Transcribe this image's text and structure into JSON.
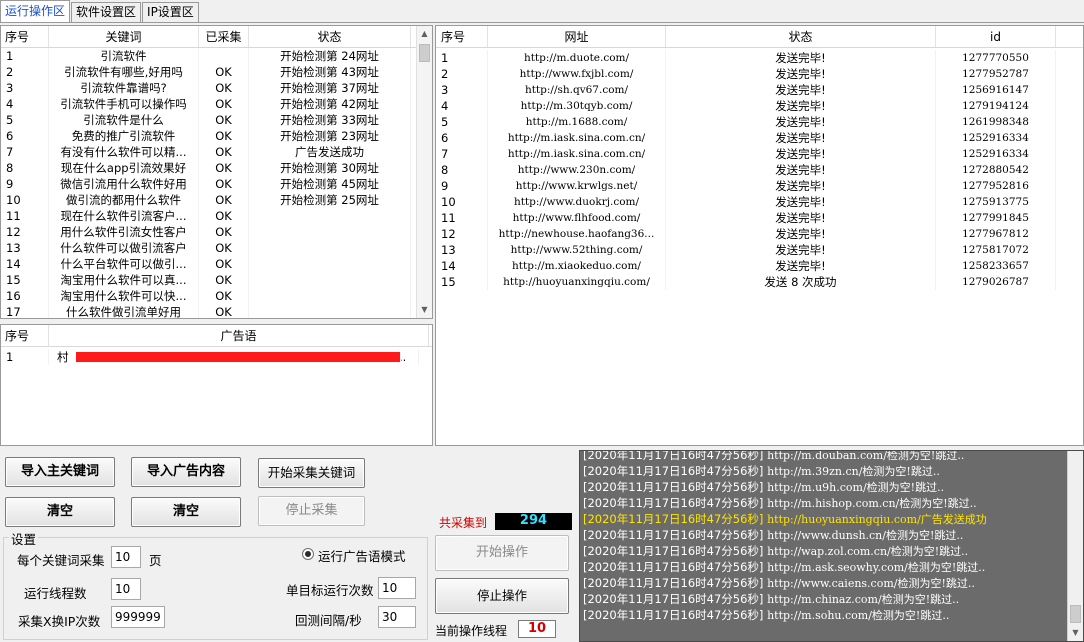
{
  "tabs": [
    "运行操作区",
    "软件设置区",
    "IP设置区"
  ],
  "keywords": {
    "headers": [
      "序号",
      "关键词",
      "已采集",
      "状态"
    ],
    "rows": [
      [
        "1",
        "引流软件",
        "",
        "开始检测第 24网址"
      ],
      [
        "2",
        "引流软件有哪些,好用吗",
        "OK",
        "开始检测第 43网址"
      ],
      [
        "3",
        "引流软件靠谱吗?",
        "OK",
        "开始检测第 37网址"
      ],
      [
        "4",
        "引流软件手机可以操作吗",
        "OK",
        "开始检测第 42网址"
      ],
      [
        "5",
        "引流软件是什么",
        "OK",
        "开始检测第 33网址"
      ],
      [
        "6",
        "免费的推广引流软件",
        "OK",
        "开始检测第 23网址"
      ],
      [
        "7",
        "有没有什么软件可以精...",
        "OK",
        "广告发送成功"
      ],
      [
        "8",
        "现在什么app引流效果好",
        "OK",
        "开始检测第 30网址"
      ],
      [
        "9",
        "微信引流用什么软件好用",
        "OK",
        "开始检测第 45网址"
      ],
      [
        "10",
        "做引流的都用什么软件",
        "OK",
        "开始检测第 25网址"
      ],
      [
        "11",
        "现在什么软件引流客户...",
        "OK",
        ""
      ],
      [
        "12",
        "用什么软件引流女性客户",
        "OK",
        ""
      ],
      [
        "13",
        "什么软件可以做引流客户",
        "OK",
        ""
      ],
      [
        "14",
        "什么平台软件可以做引...",
        "OK",
        ""
      ],
      [
        "15",
        "淘宝用什么软件可以真...",
        "OK",
        ""
      ],
      [
        "16",
        "淘宝用什么软件可以快...",
        "OK",
        ""
      ],
      [
        "17",
        "什么软件做引流单好用",
        "OK",
        ""
      ]
    ]
  },
  "ads": {
    "headers": [
      "序号",
      "广告语"
    ],
    "rows": [
      [
        "1",
        "村",
        ".."
      ]
    ]
  },
  "sites": {
    "headers": [
      "序号",
      "网址",
      "状态",
      "id"
    ],
    "rows": [
      [
        "1",
        "http://m.duote.com/",
        "发送完毕!",
        "1277770550"
      ],
      [
        "2",
        "http://www.fxjbl.com/",
        "发送完毕!",
        "1277952787"
      ],
      [
        "3",
        "http://sh.qv67.com/",
        "发送完毕!",
        "1256916147"
      ],
      [
        "4",
        "http://m.30tqyb.com/",
        "发送完毕!",
        "1279194124"
      ],
      [
        "5",
        "http://m.1688.com/",
        "发送完毕!",
        "1261998348"
      ],
      [
        "6",
        "http://m.iask.sina.com.cn/",
        "发送完毕!",
        "1252916334"
      ],
      [
        "7",
        "http://m.iask.sina.com.cn/",
        "发送完毕!",
        "1252916334"
      ],
      [
        "8",
        "http://www.230n.com/",
        "发送完毕!",
        "1272880542"
      ],
      [
        "9",
        "http://www.krwlgs.net/",
        "发送完毕!",
        "1277952816"
      ],
      [
        "10",
        "http://www.duokrj.com/",
        "发送完毕!",
        "1275913775"
      ],
      [
        "11",
        "http://www.flhfood.com/",
        "发送完毕!",
        "1277991845"
      ],
      [
        "12",
        "http://newhouse.haofang36...",
        "发送完毕!",
        "1277967812"
      ],
      [
        "13",
        "http://www.52thing.com/",
        "发送完毕!",
        "1275817072"
      ],
      [
        "14",
        "http://m.xiaokeduo.com/",
        "发送完毕!",
        "1258233657"
      ],
      [
        "15",
        "http://huoyuanxingqiu.com/",
        "发送 8 次成功",
        "1279026787"
      ]
    ]
  },
  "buttons": {
    "import_keywords": "导入主关键词",
    "import_ads": "导入广告内容",
    "start_collect": "开始采集关键词",
    "clear1": "清空",
    "clear2": "清空",
    "stop_collect": "停止采集",
    "start_op": "开始操作",
    "stop_op": "停止操作"
  },
  "settings": {
    "title": "设置",
    "per_keyword_label": "每个关键词采集",
    "per_keyword_value": "10",
    "per_keyword_unit": "页",
    "threads_label": "运行线程数",
    "threads_value": "10",
    "ip_label": "采集X换IP次数",
    "ip_value": "999999",
    "ad_mode_label": "运行广告语模式",
    "single_runs_label": "单目标运行次数",
    "single_runs_value": "10",
    "interval_label": "回测间隔/秒",
    "interval_value": "30"
  },
  "stats": {
    "total_label": "共采集到",
    "total_value": "294",
    "thread_label": "当前操作线程",
    "thread_value": "10"
  },
  "log": {
    "lines": [
      {
        "time": "[2020年11月17日16时47分56秒]",
        "text": "http://m.douban.com/检测为空!跳过..",
        "highlight": false
      },
      {
        "time": "[2020年11月17日16时47分56秒]",
        "text": "http://m.39zn.cn/检测为空!跳过..",
        "highlight": false
      },
      {
        "time": "[2020年11月17日16时47分56秒]",
        "text": "http://m.u9h.com/检测为空!跳过..",
        "highlight": false
      },
      {
        "time": "[2020年11月17日16时47分56秒]",
        "text": "http://m.hishop.com.cn/检测为空!跳过..",
        "highlight": false
      },
      {
        "time": "[2020年11月17日16时47分56秒]",
        "text": "http://huoyuanxingqiu.com/广告发送成功",
        "highlight": true
      },
      {
        "time": "[2020年11月17日16时47分56秒]",
        "text": "http://www.dunsh.cn/检测为空!跳过..",
        "highlight": false
      },
      {
        "time": "[2020年11月17日16时47分56秒]",
        "text": "http://wap.zol.com.cn/检测为空!跳过..",
        "highlight": false
      },
      {
        "time": "[2020年11月17日16时47分56秒]",
        "text": "http://m.ask.seowhy.com/检测为空!跳过..",
        "highlight": false
      },
      {
        "time": "[2020年11月17日16时47分56秒]",
        "text": "http://www.caiens.com/检测为空!跳过..",
        "highlight": false
      },
      {
        "time": "[2020年11月17日16时47分56秒]",
        "text": "http://m.chinaz.com/检测为空!跳过..",
        "highlight": false
      },
      {
        "time": "[2020年11月17日16时47分56秒]",
        "text": "http://m.sohu.com/检测为空!跳过..",
        "highlight": false
      }
    ]
  },
  "colors": {
    "log_bg": "#6b6b6b",
    "log_highlight": "#ffe500",
    "count_text": "#35e0ff",
    "thread_text": "#d00000",
    "total_label": "#d00000",
    "redaction": "#ff1a1a",
    "active_tab": "#1a4fd6"
  }
}
